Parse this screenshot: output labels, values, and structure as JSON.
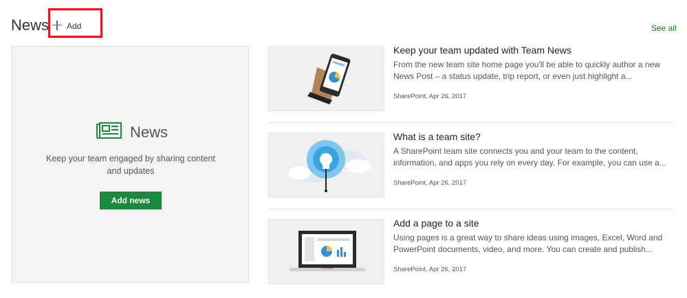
{
  "header": {
    "title": "News",
    "add_label": "Add",
    "see_all": "See all"
  },
  "featured": {
    "title": "News",
    "description": "Keep your team engaged by sharing content and updates",
    "button_label": "Add news"
  },
  "articles": [
    {
      "title": "Keep your team updated with Team News",
      "description": "From the new team site home page you'll be able to quickly author a new News Post – a status update, trip report, or even just highlight a...",
      "source": "SharePoint, Apr 26, 2017"
    },
    {
      "title": "What is a team site?",
      "description": "A SharePoint team site connects you and your team to the content, information, and apps you rely on every day. For example, you can use a...",
      "source": "SharePoint, Apr 26, 2017"
    },
    {
      "title": "Add a page to a site",
      "description": "Using pages is a great way to share ideas using images, Excel, Word and PowerPoint documents, video, and more. You can create and publish...",
      "source": "SharePoint, Apr 26, 2017"
    }
  ],
  "icons": {
    "add": "plus-icon",
    "featured": "newspaper-icon",
    "article_1": "phone-in-hand-icon",
    "article_2": "lightbulb-cloud-icon",
    "article_3": "laptop-chart-icon"
  },
  "colors": {
    "accent_green": "#107c10",
    "button_green": "#1b8a3f",
    "highlight_red": "#e8141f"
  }
}
